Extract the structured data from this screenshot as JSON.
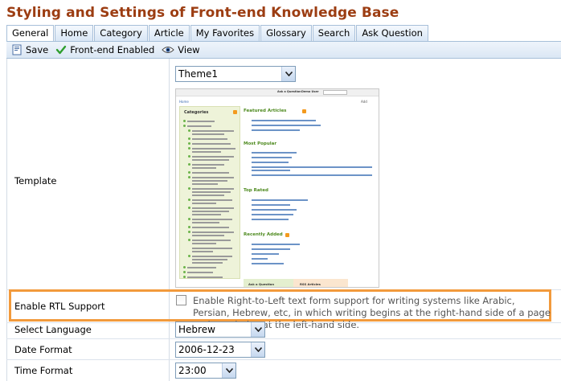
{
  "page": {
    "title": "Styling and Settings of Front-end Knowledge Base"
  },
  "tabs": [
    {
      "label": "General",
      "active": true
    },
    {
      "label": "Home"
    },
    {
      "label": "Category"
    },
    {
      "label": "Article"
    },
    {
      "label": "My Favorites"
    },
    {
      "label": "Glossary"
    },
    {
      "label": "Search"
    },
    {
      "label": "Ask Question"
    }
  ],
  "toolbar": {
    "save_label": "Save",
    "frontend_label": "Front-end Enabled",
    "view_label": "View"
  },
  "template": {
    "label": "Template",
    "value": "Theme1",
    "preview": {
      "top_links": [
        "Ask a Question",
        "Demo User"
      ],
      "home": "Home",
      "add": "Add",
      "categories_title": "Categories",
      "featured": "Featured Articles",
      "popular": "Most Popular",
      "top_rated": "Top Rated",
      "recent": "Recently Added",
      "ask": "Ask a Question",
      "rss": "RSS Articles"
    }
  },
  "rtl": {
    "label": "Enable RTL Support",
    "checked": false,
    "description": "Enable Right-to-Left text form support for writing systems like Arabic, Persian, Hebrew, etc, in which writing begins at the right-hand side of a page and concludes at the left-hand side."
  },
  "language": {
    "label": "Select Language",
    "value": "Hebrew"
  },
  "date_format": {
    "label": "Date Format",
    "value": "2006-12-23"
  },
  "time_format": {
    "label": "Time Format",
    "value": "23:00"
  },
  "colors": {
    "title": "#9c3d12",
    "highlight": "#f29a3c",
    "tab_border": "#a7bfd9"
  }
}
